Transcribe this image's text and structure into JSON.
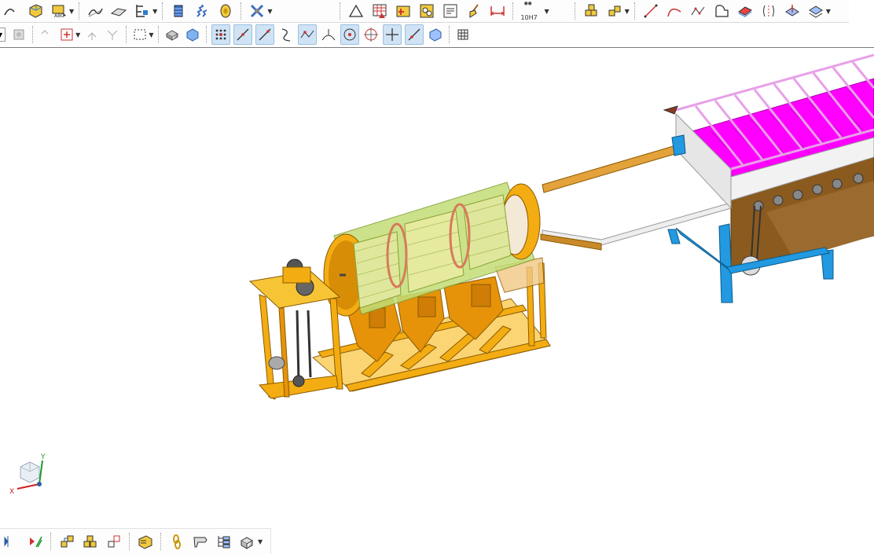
{
  "toolbar_top": {
    "icons": [
      "curve-tool-icon",
      "cube-icon",
      "abc-text-icon",
      "surface-icon",
      "surface-alt-icon",
      "datum-icon",
      "cylinder-icon",
      "spring-icon",
      "pulley-icon",
      "tools-icon",
      "triangle-icon",
      "table-grid-icon",
      "chart-add-icon",
      "gear-doc-icon",
      "document-icon",
      "broom-icon",
      "tolerance-icon",
      "assembly-icon",
      "assembly-alt-icon",
      "line-icon",
      "arc-icon",
      "spline-points-icon",
      "shape-icon",
      "flatten-icon",
      "split-icon",
      "layer-icon",
      "layer-alt-icon"
    ],
    "tolerance_label": "10H7"
  },
  "toolbar_second": {
    "combo_value": "",
    "icons": [
      "transform-icon",
      "copy-icon",
      "translate-icon",
      "rotate-icon",
      "select-box-icon",
      "box-solid-icon",
      "box-shaded-icon",
      "snap-grid-icon",
      "snap-line-icon",
      "snap-tangent-icon",
      "curve-icon",
      "snap-point-icon",
      "snap-intersect-icon",
      "snap-center-icon",
      "snap-circle-icon",
      "snap-cross-icon",
      "snap-perp-icon",
      "view-icon",
      "mesh-icon"
    ]
  },
  "toolbar_bottom": {
    "icons": [
      "mirror-icon",
      "align-icon",
      "assembly-tree-icon",
      "components-icon",
      "link-icon",
      "book-icon",
      "chain-icon",
      "wrench-icon",
      "hierarchy-icon",
      "explode-icon"
    ]
  },
  "axis_triad": {
    "x_label": "X",
    "y_label": "Y"
  },
  "colors": {
    "frame": "#f0a800",
    "drum_green": "#b8d36a",
    "conveyor_pink": "#ff3fd0",
    "roller_magenta": "#ff00ff",
    "stand_blue": "#2299e0",
    "chute_brown": "#c98a2a"
  }
}
